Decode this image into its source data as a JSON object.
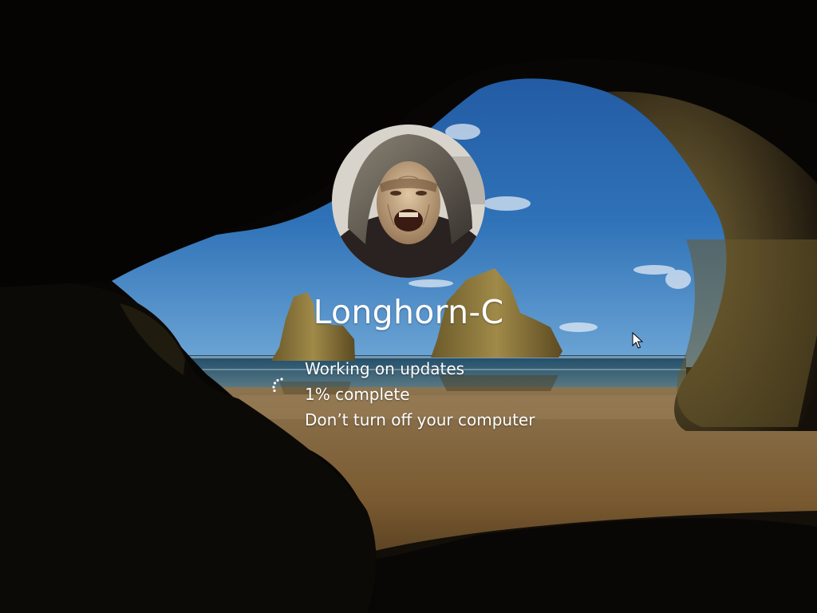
{
  "user": {
    "name": "Longhorn-C",
    "avatar_icon": "user-avatar-photo"
  },
  "update_status": {
    "line1": "Working on updates",
    "line2": "1% complete",
    "line3": "Don’t turn off your computer",
    "progress_percent": 1,
    "spinner_icon": "loading-spinner-icon"
  },
  "colors": {
    "text": "#ffffff",
    "sky": "#2a67b0",
    "sand": "#8a6a3c"
  }
}
